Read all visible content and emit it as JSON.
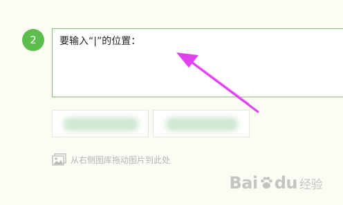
{
  "step": {
    "number": "2"
  },
  "editor": {
    "text": "要输入“|”的位置："
  },
  "annotation": {
    "arrow_color": "#e040f0"
  },
  "hint": {
    "text": "从右侧图库拖动图片到此处",
    "icon": "image-icon"
  },
  "watermark": {
    "text_left": "Bai",
    "text_right": "经验",
    "tail": "du"
  },
  "colors": {
    "badge": "#5cbf4d",
    "border": "#7cc46f",
    "background": "#fcfcf4"
  }
}
